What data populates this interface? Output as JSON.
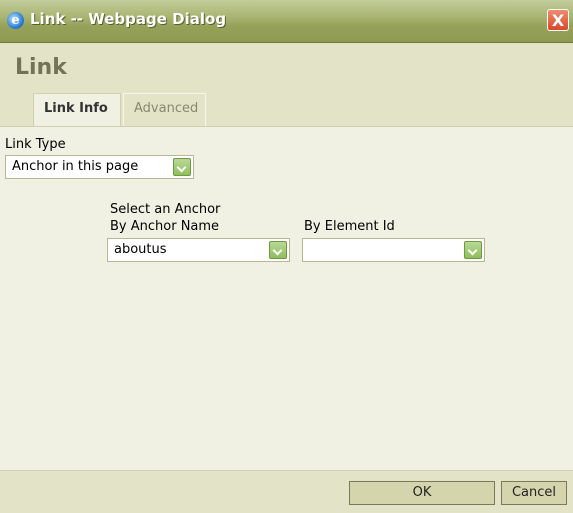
{
  "window": {
    "title": "Link -- Webpage Dialog",
    "app_icon": "ie-icon",
    "close_label": "X"
  },
  "dialog": {
    "title": "Link",
    "tabs": [
      {
        "label": "Link Info",
        "active": true
      },
      {
        "label": "Advanced",
        "active": false
      }
    ]
  },
  "form": {
    "link_type_label": "Link Type",
    "link_type_value": "Anchor in this page",
    "select_anchor_label": "Select an Anchor",
    "by_anchor_name_label": "By Anchor Name",
    "by_anchor_name_value": "aboutus",
    "by_element_id_label": "By Element Id",
    "by_element_id_value": ""
  },
  "footer": {
    "ok_label": "OK",
    "cancel_label": "Cancel"
  },
  "colors": {
    "titlebar": "#96a25a",
    "header_bg": "#e3e3c7",
    "content_bg": "#f1f1e3",
    "dropdown_button": "#8fbf5b",
    "close_button": "#d9482a"
  }
}
